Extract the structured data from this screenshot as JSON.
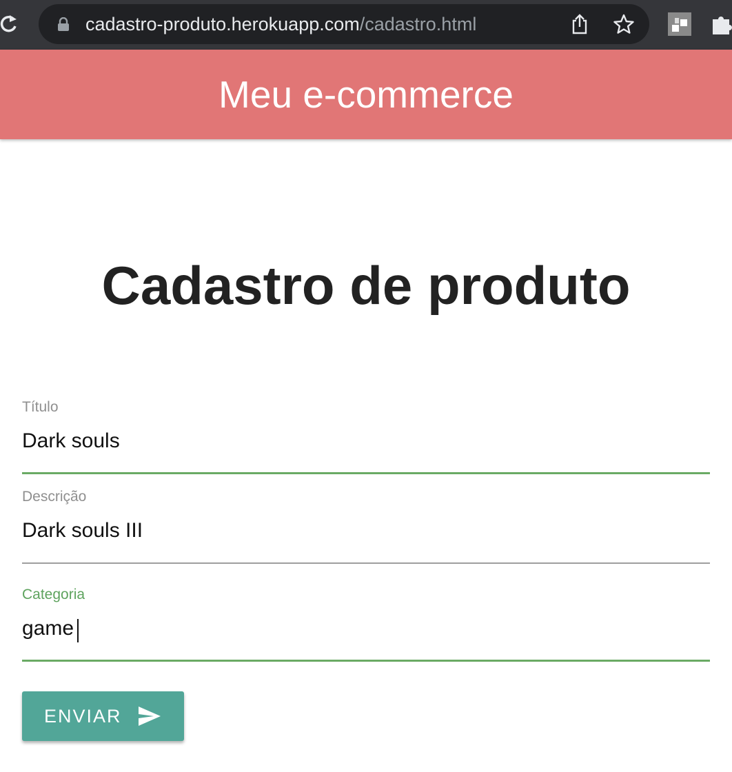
{
  "browser": {
    "url_host": "cadastro-produto.herokuapp.com",
    "url_path": "/cadastro.html",
    "icons": [
      "reload-icon",
      "lock-icon",
      "share-icon",
      "star-icon",
      "extension-icon",
      "puzzle-icon"
    ]
  },
  "header": {
    "title": "Meu e-commerce",
    "color": "#e17676"
  },
  "main": {
    "title": "Cadastro de produto"
  },
  "form": {
    "fields": [
      {
        "label": "Título",
        "value": "Dark souls",
        "state": "filled"
      },
      {
        "label": "Descrição",
        "value": "Dark souls III",
        "state": "default"
      },
      {
        "label": "Categoria",
        "value": "game",
        "state": "focused"
      }
    ],
    "submit_label": "ENVIAR",
    "submit_icon": "send-icon",
    "accent_color": "#6aaa64",
    "button_color": "#52a698"
  }
}
